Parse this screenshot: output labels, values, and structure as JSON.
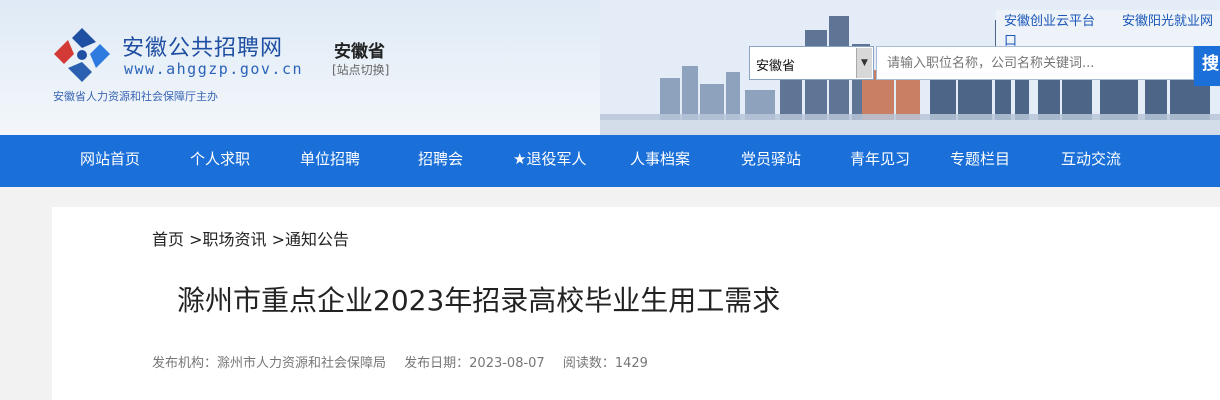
{
  "brand": {
    "title": "安徽公共招聘网",
    "url": "www.ahggzp.gov.cn",
    "province": "安徽省",
    "switch_site": "[站点切换]",
    "sponsor": "安徽省人力资源和社会保障厅主办"
  },
  "top_links": {
    "link1": "安徽创业云平台",
    "link2": "安徽阳光就业网",
    "link2_tail": "口"
  },
  "search": {
    "region": "安徽省",
    "placeholder": "请输入职位名称，公司名称关键词...",
    "button_label": "搜"
  },
  "nav": {
    "items": [
      {
        "label": "网站首页"
      },
      {
        "label": "个人求职"
      },
      {
        "label": "单位招聘"
      },
      {
        "label": "招聘会"
      },
      {
        "label": "★退役军人"
      },
      {
        "label": "人事档案"
      },
      {
        "label": "党员驿站"
      },
      {
        "label": "青年见习"
      },
      {
        "label": "专题栏目"
      },
      {
        "label": "互动交流"
      }
    ]
  },
  "breadcrumb": "首页 >职场资讯 >通知公告",
  "article": {
    "title": "滁州市重点企业2023年招录高校毕业生用工需求",
    "publisher": "发布机构：滁州市人力资源和社会保障局",
    "publish_date": "发布日期：2023-08-07",
    "views": "阅读数：1429"
  },
  "colors": {
    "nav_bg": "#1a6fd8",
    "brand_blue": "#1f4fa3"
  }
}
